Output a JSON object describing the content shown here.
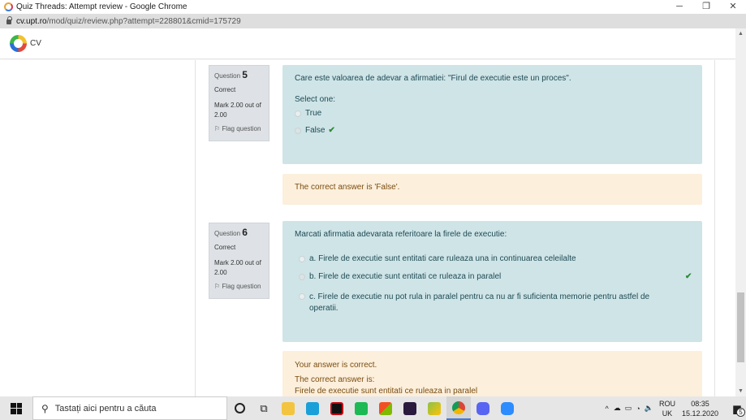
{
  "window": {
    "title": "Quiz Threads: Attempt review - Google Chrome",
    "controls": [
      "─",
      "❐",
      "✕"
    ]
  },
  "address": {
    "domain": "cv.upt.ro",
    "path": "/mod/quiz/review.php?attempt=228801&cmid=175729"
  },
  "site": {
    "name": "CV"
  },
  "questions": [
    {
      "label": "Question",
      "number": "5",
      "status": "Correct",
      "mark": "Mark 2.00 out of 2.00",
      "flag": "Flag question",
      "text": "Care este valoarea de adevar a afirmatiei: \"Firul de executie este un proces\".",
      "prompt": "Select one:",
      "options": [
        {
          "label": "True"
        },
        {
          "label": "False"
        }
      ],
      "feedback": [
        "The correct answer is 'False'."
      ]
    },
    {
      "label": "Question",
      "number": "6",
      "status": "Correct",
      "mark": "Mark 2.00 out of 2.00",
      "flag": "Flag question",
      "text": "Marcati afirmatia adevarata referitoare la firele de executie:",
      "options": [
        {
          "label": "a. Firele de executie sunt entitati care ruleaza una in continuarea celeilalte"
        },
        {
          "label": "b. Firele de executie sunt entitati ce ruleaza in paralel"
        },
        {
          "label": "c. Firele de executie nu pot rula in paralel pentru ca nu ar fi suficienta memorie pentru astfel de operatii."
        }
      ],
      "feedback": [
        "Your answer is correct.",
        "The correct answer is:",
        "Firele de executie sunt entitati ce ruleaza in paralel"
      ]
    }
  ],
  "taskbar": {
    "search_placeholder": "Tastați aici pentru a căuta",
    "lang_top": "ROU",
    "lang_bottom": "UK",
    "time": "08:35",
    "date": "15.12.2020",
    "notifications": "5"
  },
  "colors": {
    "question_bg": "#cfe4e7",
    "feedback_bg": "#fcefdc",
    "info_bg": "#dee2e6",
    "correct": "#2e8b3a"
  }
}
